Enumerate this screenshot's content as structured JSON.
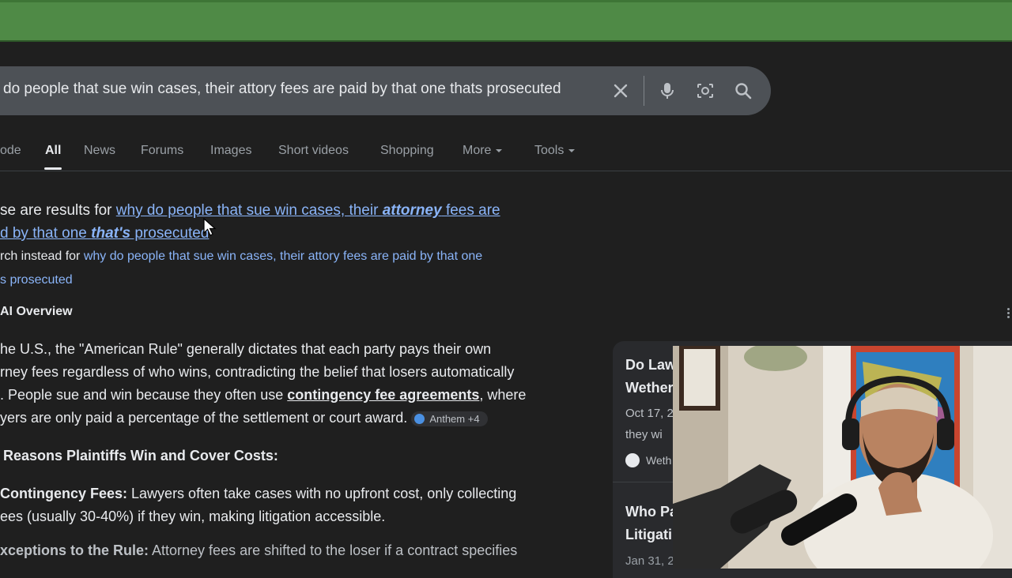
{
  "search": {
    "query": "do people that sue win cases, their attory fees are paid by that one thats prosecuted"
  },
  "tabs": [
    "ode",
    "All",
    "News",
    "Forums",
    "Images",
    "Short videos",
    "Shopping",
    "More",
    "Tools"
  ],
  "correction": {
    "showing_prefix": "se are results for",
    "corrected_part1": "why do people that sue win cases, their ",
    "corrected_bold1": "attorney",
    "corrected_part2": " fees are",
    "line2_part1": "d by that one ",
    "line2_bold": "that's",
    "line2_part2": " prosecuted",
    "search_instead_prefix": "rch instead for",
    "original_line1": "why do people that sue win cases, their attory fees are paid by that one",
    "original_line2": "s prosecuted"
  },
  "ai_overview": {
    "heading": "AI Overview",
    "para_line1": "he U.S., the \"American Rule\" generally dictates that each party pays their own",
    "para_line2": "rney fees regardless of who wins, contradicting the belief that losers automatically",
    "para_line3a": ". People sue and win because they often use ",
    "para_line3b": "contingency fee agreements",
    "para_line3c": ", where",
    "para_line4": "yers are only paid a percentage of the settlement or court award.",
    "chip": "Anthem +4",
    "subheading": "Reasons Plaintiffs Win and Cover Costs:",
    "item1_label": "Contingency Fees:",
    "item1_text1": " Lawyers often take cases with no upfront cost, only collecting",
    "item1_text2": "ees (usually 30-40%) if they win, making litigation accessible.",
    "item2_label": "xceptions to the Rule:",
    "item2_text": " Attorney fees are shifted to the loser if a contract specifies"
  },
  "side_results": [
    {
      "title1": "Do Law",
      "title2": "Wether",
      "date": "Oct 17, 2",
      "snippet": "they wi",
      "source": "Weth"
    },
    {
      "title1": "Who Pa",
      "title2": "Litigati",
      "date": "Jan 31, 2"
    }
  ],
  "colors": {
    "topbar": "#4f8a46",
    "background": "#1f1f1f",
    "link": "#8ab4f8",
    "searchbox": "#4d5156"
  }
}
